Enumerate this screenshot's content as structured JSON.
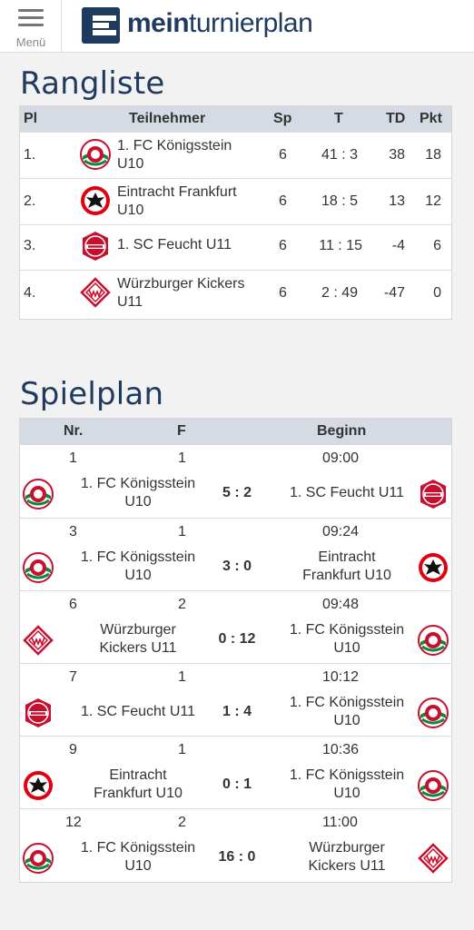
{
  "header": {
    "menu_label": "Menü",
    "logo_bold": "mein",
    "logo_rest": "turnierplan"
  },
  "ranking": {
    "title": "Rangliste",
    "columns": {
      "pl": "Pl",
      "team": "Teilnehmer",
      "sp": "Sp",
      "t": "T",
      "td": "TD",
      "pkt": "Pkt"
    },
    "rows": [
      {
        "pl": "1.",
        "team_line1": "1. FC Königsstein",
        "team_line2": "U10",
        "crest": "koenigsstein-crest-icon",
        "sp": "6",
        "t": "41 : 3",
        "td": "38",
        "pkt": "18"
      },
      {
        "pl": "2.",
        "team_line1": "Eintracht Frankfurt",
        "team_line2": "U10",
        "crest": "eintracht-frankfurt-crest-icon",
        "sp": "6",
        "t": "18 : 5",
        "td": "13",
        "pkt": "12"
      },
      {
        "pl": "3.",
        "team_line1": "1. SC Feucht U11",
        "team_line2": "",
        "crest": "sc-feucht-crest-icon",
        "sp": "6",
        "t": "11 : 15",
        "td": "-4",
        "pkt": "6"
      },
      {
        "pl": "4.",
        "team_line1": "Würzburger Kickers",
        "team_line2": "U11",
        "crest": "wuerzburger-kickers-crest-icon",
        "sp": "6",
        "t": "2 : 49",
        "td": "-47",
        "pkt": "0"
      }
    ]
  },
  "schedule": {
    "title": "Spielplan",
    "columns": {
      "nr": "Nr.",
      "f": "F",
      "beginn": "Beginn"
    },
    "matches": [
      {
        "nr": "1",
        "f": "1",
        "time": "09:00",
        "home1": "1. FC Königsstein",
        "home2": "U10",
        "score": "5 : 2",
        "away1": "1. SC Feucht U11",
        "away2": ""
      },
      {
        "nr": "3",
        "f": "1",
        "time": "09:24",
        "home1": "1. FC Königsstein",
        "home2": "U10",
        "score": "3 : 0",
        "away1": "Eintracht",
        "away2": "Frankfurt U10"
      },
      {
        "nr": "6",
        "f": "2",
        "time": "09:48",
        "home1": "Würzburger",
        "home2": "Kickers U11",
        "score": "0 : 12",
        "away1": "1. FC Königsstein",
        "away2": "U10"
      },
      {
        "nr": "7",
        "f": "1",
        "time": "10:12",
        "home1": "1. SC Feucht U11",
        "home2": "",
        "score": "1 : 4",
        "away1": "1. FC Königsstein",
        "away2": "U10"
      },
      {
        "nr": "9",
        "f": "1",
        "time": "10:36",
        "home1": "Eintracht",
        "home2": "Frankfurt U10",
        "score": "0 : 1",
        "away1": "1. FC Königsstein",
        "away2": "U10"
      },
      {
        "nr": "12",
        "f": "2",
        "time": "11:00",
        "home1": "1. FC Königsstein",
        "home2": "U10",
        "score": "16 : 0",
        "away1": "Würzburger",
        "away2": "Kickers U11"
      }
    ]
  },
  "colors": {
    "brand": "#1e3a5f",
    "table_header": "#d5dbe3"
  }
}
